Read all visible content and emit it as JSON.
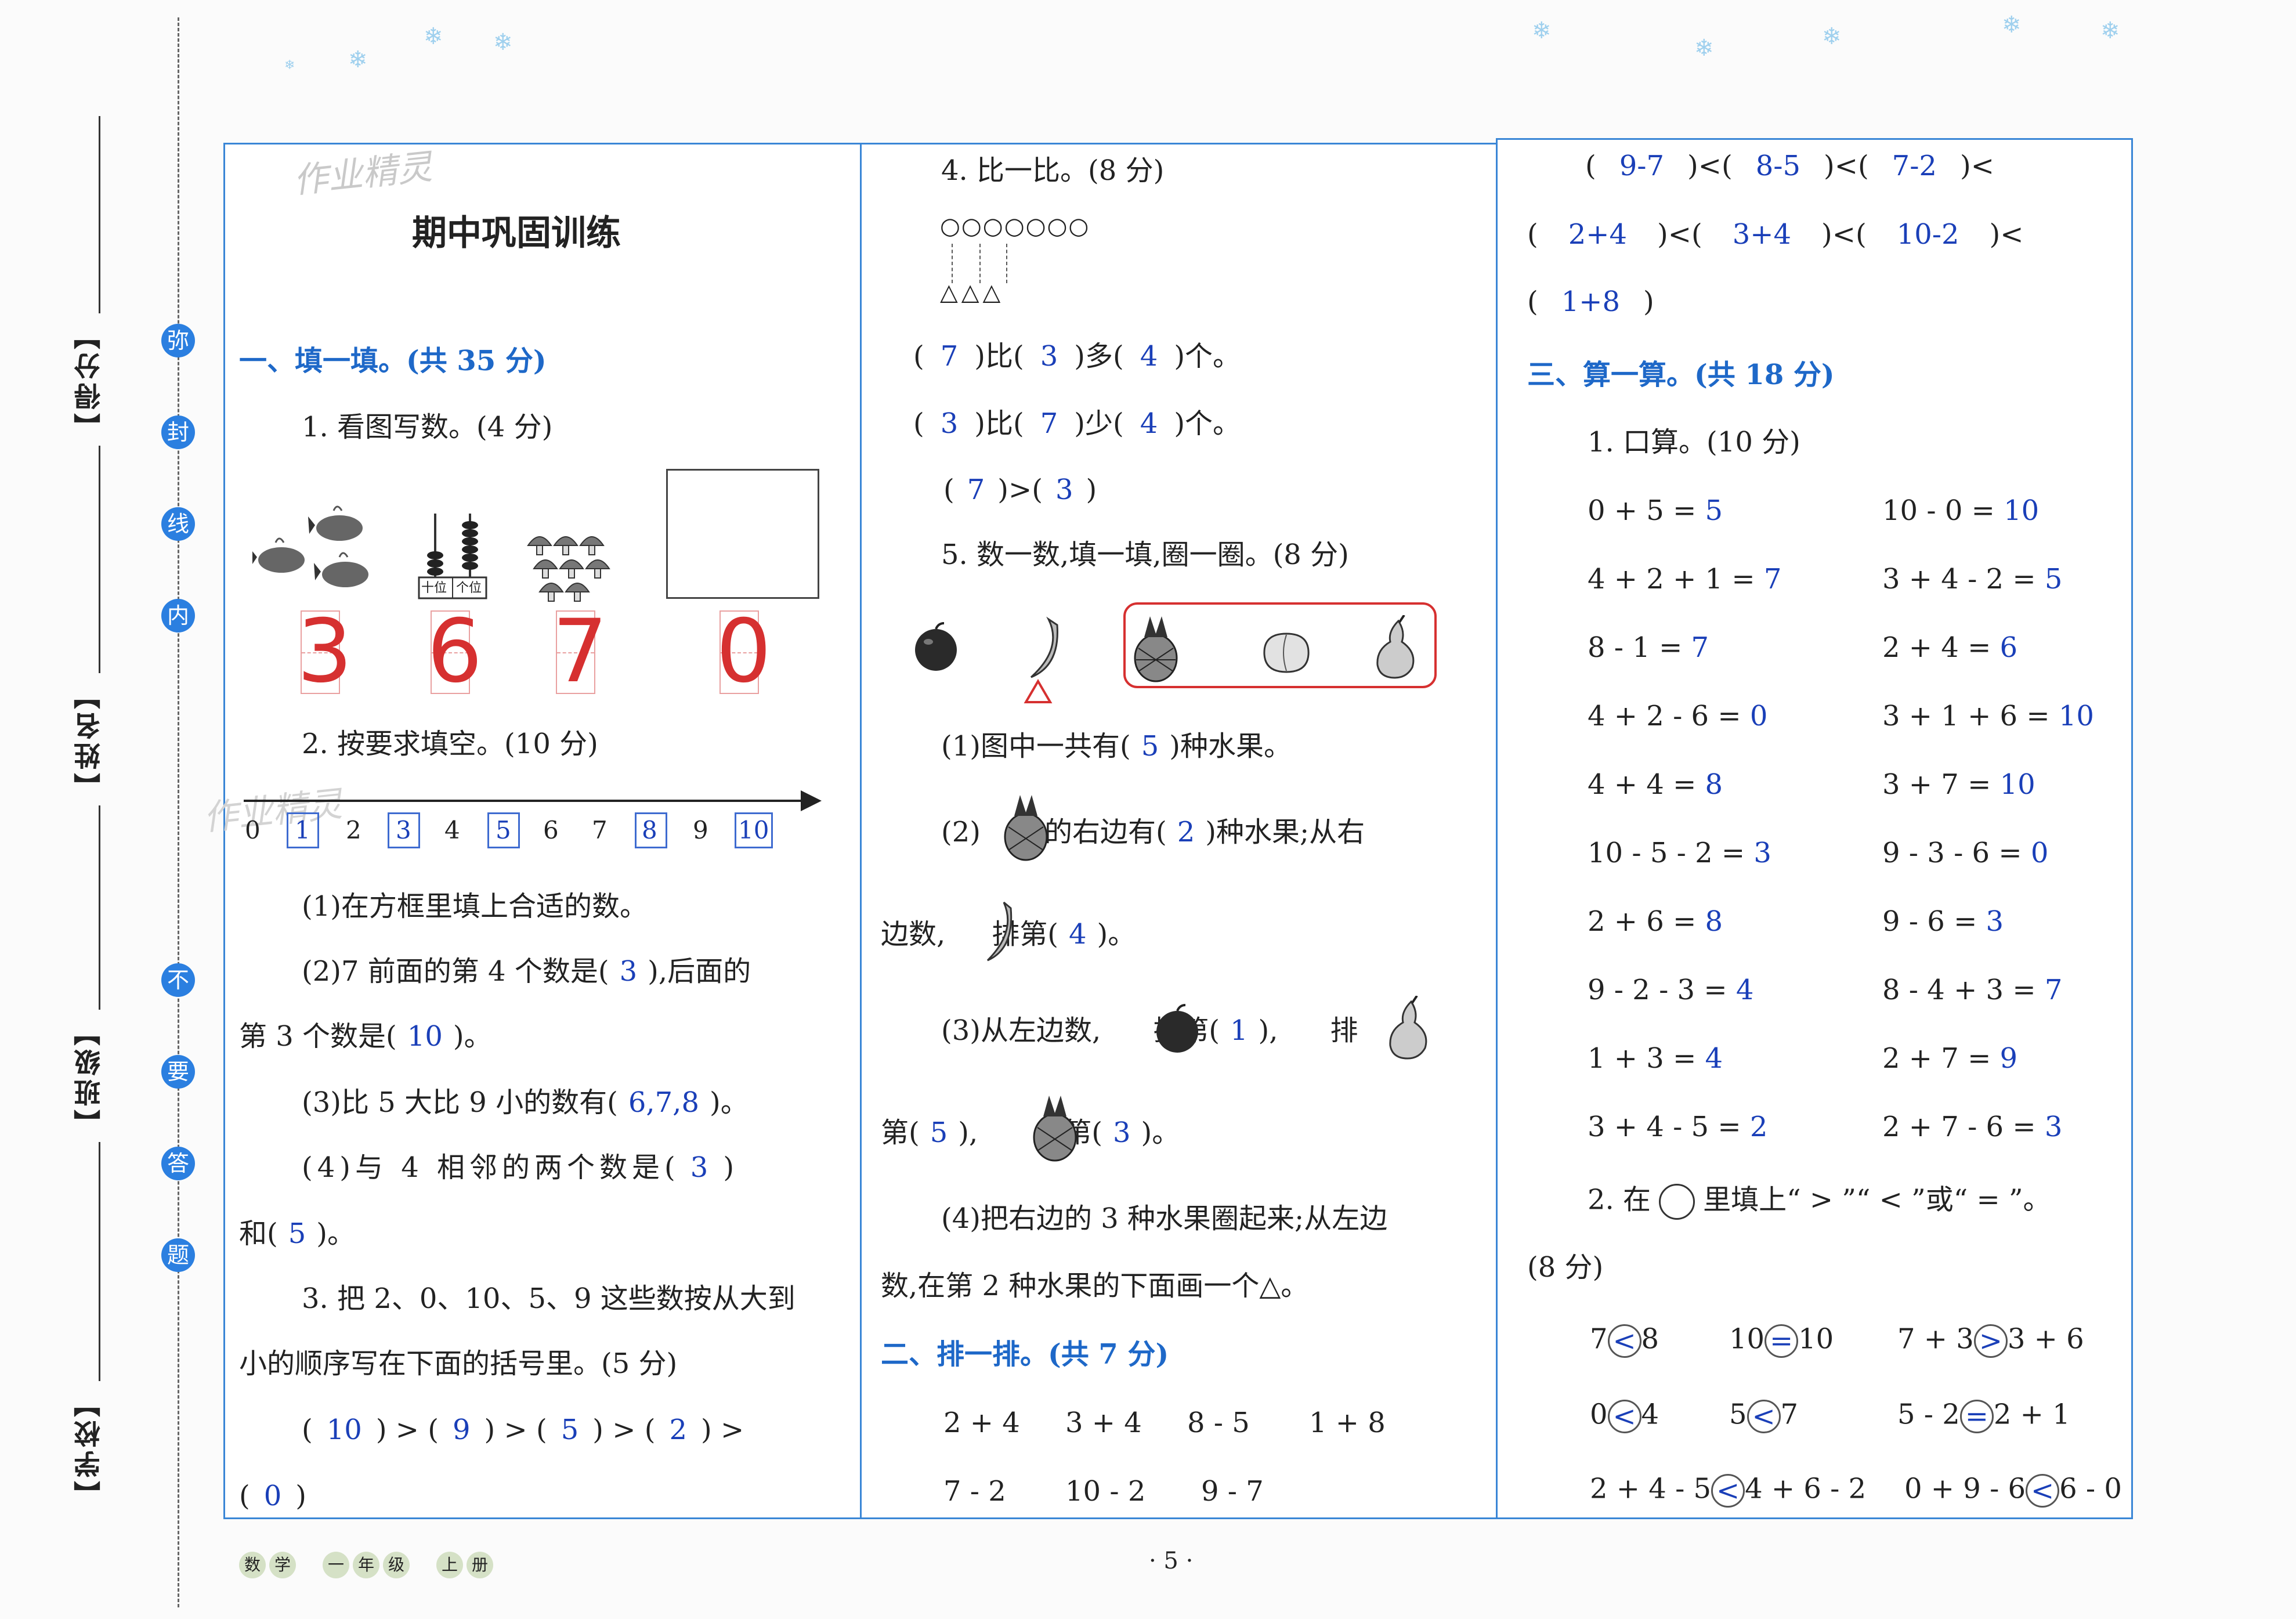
{
  "margin": {
    "circles_top": [
      "弥",
      "封",
      "线",
      "内"
    ],
    "circles_bottom": [
      "不",
      "要",
      "答",
      "题"
    ],
    "labels": [
      "【得分】",
      "【姓名】",
      "【班级】",
      "【学校】"
    ]
  },
  "watermark": "作业精灵",
  "col1": {
    "title": "期中巩固训练",
    "sec1_head": "一、填一填。(共 35 分)",
    "q1": "1. 看图写数。(4 分)",
    "q1_answers": [
      "3",
      "6",
      "7",
      "0"
    ],
    "abacus_labels": [
      "十位",
      "个位"
    ],
    "q2": "2. 按要求填空。(10 分)",
    "numberline": [
      "0",
      "1",
      "2",
      "3",
      "4",
      "5",
      "6",
      "7",
      "8",
      "9",
      "10"
    ],
    "q2_1": "(1)在方框里填上合适的数。",
    "q2_2a": "(2)7 前面的第 4 个数是(",
    "q2_2a_ans": "3",
    "q2_2b": "),后面的",
    "q2_2c": "第 3 个数是(",
    "q2_2c_ans": "10",
    "q2_2d": ")。",
    "q2_3a": "(3)比 5 大比 9 小的数有(",
    "q2_3_ans": "6,7,8",
    "q2_3b": ")。",
    "q2_4a": "(4)与 4 相邻的两个数是(",
    "q2_4_ans1": "3",
    "q2_4b": ")",
    "q2_4c": "和(",
    "q2_4_ans2": "5",
    "q2_4d": ")。",
    "q3a": "3. 把 2、0、10、5、9 这些数按从大到",
    "q3b": "小的顺序写在下面的括号里。(5 分)",
    "q3_ans": [
      "10",
      "9",
      "5",
      "2",
      "0"
    ]
  },
  "col2": {
    "q4": "4. 比一比。(8 分)",
    "circles": "○○○○○○○",
    "triangles": "△△△",
    "q4_l1": [
      "(",
      "7",
      ")比(",
      "3",
      ")多(",
      "4",
      ")个。"
    ],
    "q4_l2": [
      "(",
      "3",
      ")比(",
      "7",
      ")少(",
      "4",
      ")个。"
    ],
    "q4_l3": [
      "(",
      "7",
      ")>(",
      "3",
      ")"
    ],
    "q5": "5. 数一数,填一填,圈一圈。(8 分)",
    "q5_1a": "(1)图中一共有(",
    "q5_1_ans": "5",
    "q5_1b": ")种水果。",
    "q5_2a": "(2)",
    "q5_2b": "的右边有(",
    "q5_2_ans": "2",
    "q5_2c": ")种水果;从右",
    "q5_2d": "边数,",
    "q5_2e": "排第(",
    "q5_2_ans2": "4",
    "q5_2f": ")。",
    "q5_3a": "(3)从左边数,",
    "q5_3b": "排第(",
    "q5_3_ans1": "1",
    "q5_3c": "),",
    "q5_3d": "排",
    "q5_3e": "第(",
    "q5_3_ans2": "5",
    "q5_3f": "),",
    "q5_3g": "排第(",
    "q5_3_ans3": "3",
    "q5_3h": ")。",
    "q5_4a": "(4)把右边的 3 种水果圈起来;从左边",
    "q5_4b": "数,在第 2 种水果的下面画一个△。",
    "sec2_head": "二、排一排。(共 7 分)",
    "sec2_row1": [
      "2 + 4",
      "3 + 4",
      "8 - 5",
      "1 + 8"
    ],
    "sec2_row2": [
      "7 - 2",
      "10 - 2",
      "9 - 7"
    ]
  },
  "col3": {
    "order_row1": [
      "(",
      "9-7",
      ")<(",
      "8-5",
      ")<(",
      "7-2",
      ")<"
    ],
    "order_row2": [
      "(",
      "2+4",
      ")<(",
      "3+4",
      ")<(",
      "10-2",
      ")<"
    ],
    "order_row3": [
      "(",
      "1+8",
      ")"
    ],
    "sec3_head": "三、算一算。(共 18 分)",
    "q1": "1. 口算。(10 分)",
    "calc": [
      [
        "0 + 5 = ",
        "5",
        "10 - 0 = ",
        "10"
      ],
      [
        "4 + 2 + 1 = ",
        "7",
        "3 + 4 - 2 = ",
        "5"
      ],
      [
        "8 - 1 = ",
        "7",
        "2 + 4 = ",
        "6"
      ],
      [
        "4 + 2 - 6 = ",
        "0",
        "3 + 1 + 6 = ",
        "10"
      ],
      [
        "4 + 4 = ",
        "8",
        "3 + 7 = ",
        "10"
      ],
      [
        "10 - 5 - 2 = ",
        "3",
        "9 - 3 - 6 = ",
        "0"
      ],
      [
        "2 + 6 = ",
        "8",
        "9 - 6 = ",
        "3"
      ],
      [
        "9 - 2 - 3 = ",
        "4",
        "8 - 4 + 3 = ",
        "7"
      ],
      [
        "1 + 3 = ",
        "4",
        "2 + 7 = ",
        "9"
      ],
      [
        "3 + 4 - 5 = ",
        "2",
        "2 + 7 - 6 = ",
        "3"
      ]
    ],
    "q2a": "2. 在",
    "q2b": "里填上“ > ”“ < ”或“ = ”。",
    "q2c": "(8 分)",
    "cmp": [
      [
        [
          "7",
          "<",
          "8"
        ],
        [
          "10",
          "=",
          "10"
        ],
        [
          "7 + 3",
          ">",
          "3 + 6"
        ]
      ],
      [
        [
          "0",
          "<",
          "4"
        ],
        [
          "5",
          "<",
          "7"
        ],
        [
          "5 - 2",
          "=",
          "2 + 1"
        ]
      ],
      [
        [
          "2 + 4 - 5",
          "<",
          "4 + 6 - 2"
        ],
        [
          "0 + 9 - 6",
          "<",
          "6 - 0"
        ]
      ]
    ]
  },
  "footer": {
    "book": [
      "数",
      "学",
      "一",
      "年",
      "级",
      "上",
      "册"
    ],
    "page": "· 5 ·"
  }
}
